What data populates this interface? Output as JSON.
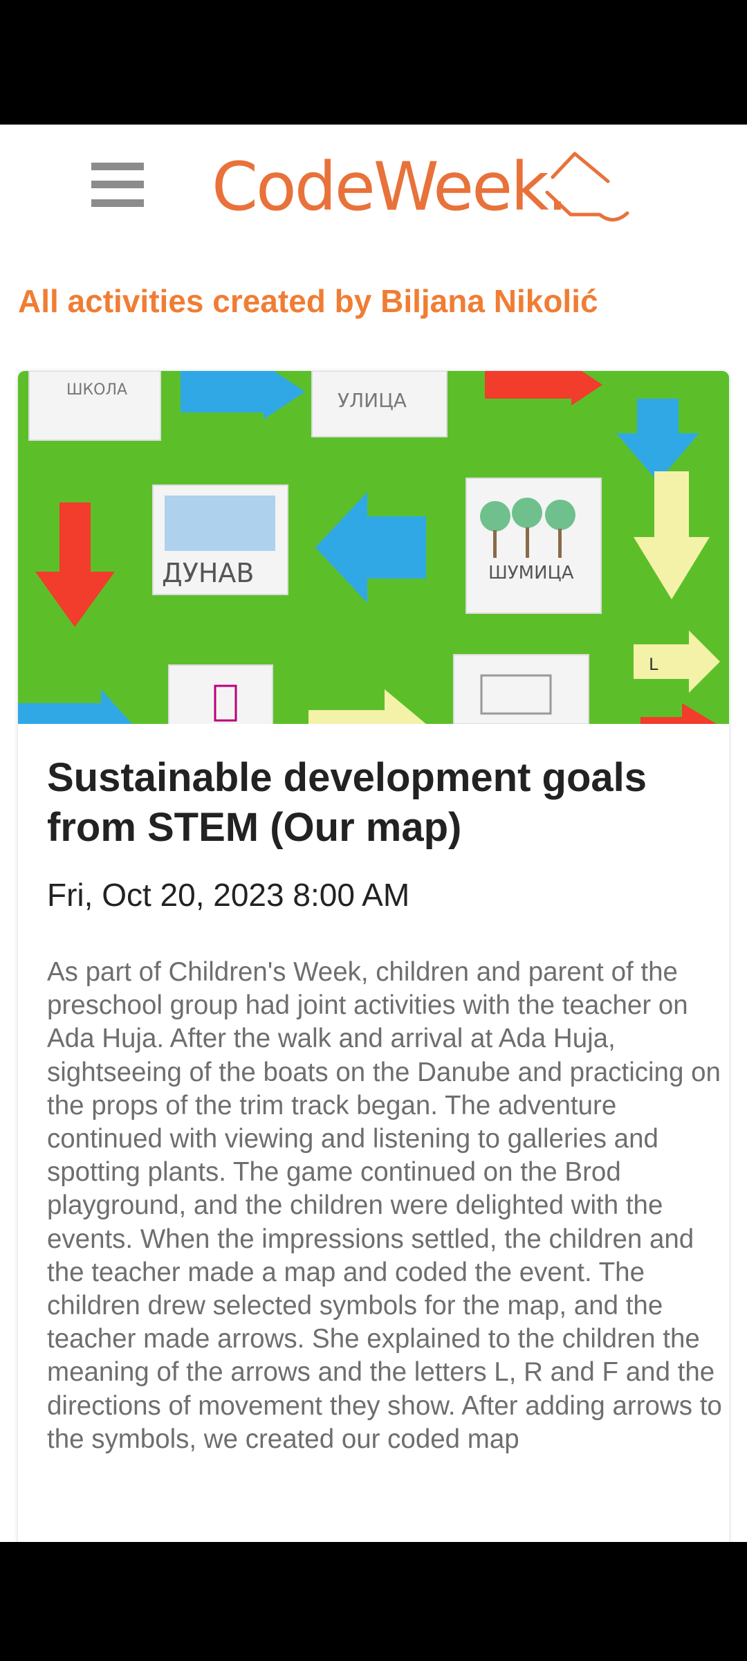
{
  "header": {
    "menu_icon": "hamburger-menu-icon",
    "logo_text": "CodeWeek."
  },
  "page": {
    "section_title": "All activities created by Biljana Nikolić"
  },
  "activity": {
    "image": {
      "labels": [
        "ШКОЛА",
        "УЛИЦА",
        "ДУНАВ",
        "ШУМИЦА",
        "L"
      ]
    },
    "title": "Sustainable development goals from STEM (Our map)",
    "date": "Fri, Oct 20, 2023 8:00 AM",
    "description": "As part of Children's Week, children and parent of the preschool group had joint activities with the teacher on Ada Huja. After the walk and arrival at Ada Huja, sightseeing of the boats on the Danube and practicing on the props of the trim track began. The adventure continued with viewing and listening to galleries and spotting plants. The game continued on the Brod playground, and the children were delighted with the events. When the impressions settled, the children and the teacher made a map and coded the event. The children drew selected symbols for the map, and the teacher made arrows. She explained to the children the meaning of the arrows and the letters L, R and F and the directions of movement they show. After adding arrows to the symbols, we created our coded map"
  },
  "colors": {
    "accent": "#f07d34",
    "logo": "#e8723a",
    "title_text": "#222222",
    "body_text": "#6e6e6e",
    "image_background": "#5cbf2a"
  }
}
